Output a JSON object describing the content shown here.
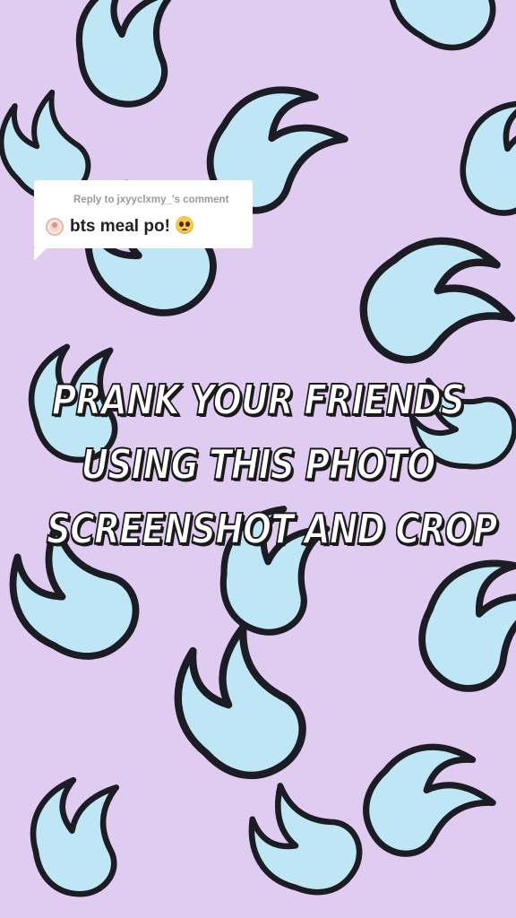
{
  "background": {
    "color": "#e1ccf1",
    "pattern": "blue-flame-icons",
    "flame_fill": "#bfe6f4",
    "flame_stroke": "#1c1c24"
  },
  "reply_card": {
    "header": "Reply to jxyyclxmy_'s comment",
    "comment": "bts meal po!",
    "emoji": "pleading-face-icon"
  },
  "headline": {
    "lines": [
      "PRANK YOUR FRIENDS",
      "USING THIS PHOTO",
      "SCREENSHOT AND CROP"
    ]
  }
}
